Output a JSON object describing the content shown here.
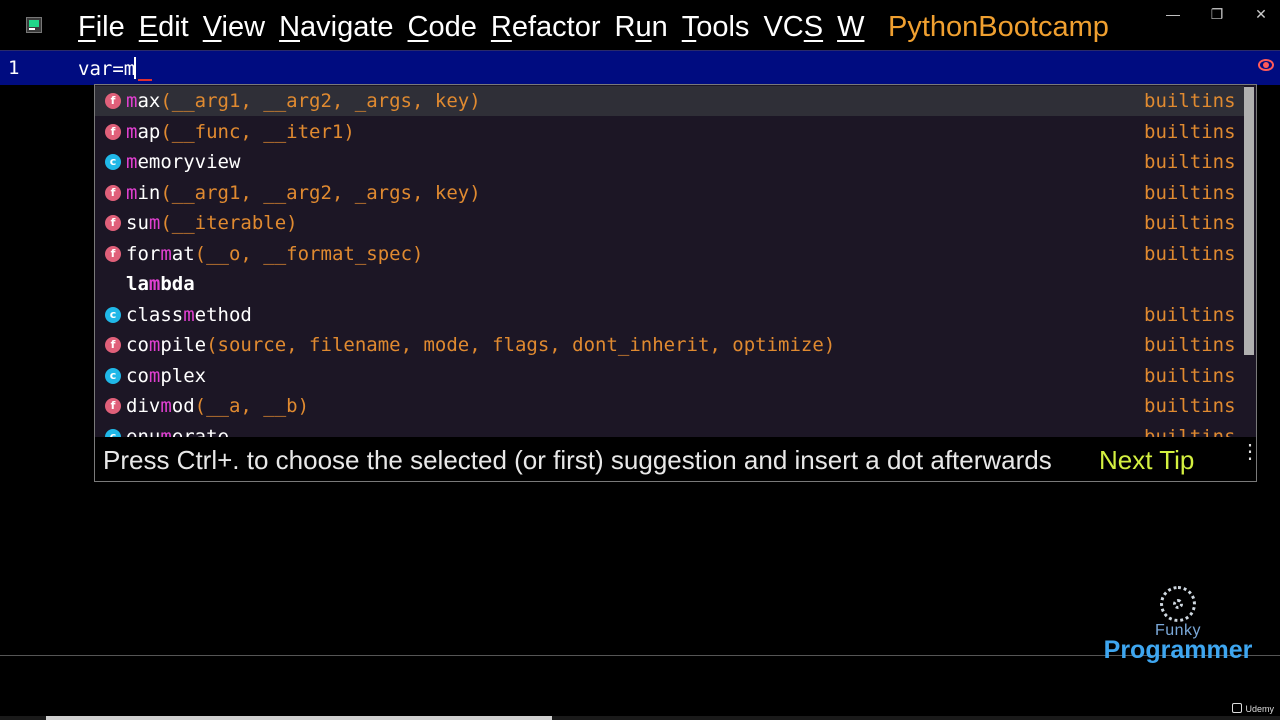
{
  "window": {
    "app_icon": "pycharm-icon",
    "project_title": "PythonBootcamp",
    "controls": {
      "minimize": "—",
      "restore": "❐",
      "close": "✕"
    }
  },
  "menu": [
    {
      "label": "File",
      "id": "file"
    },
    {
      "label": "Edit",
      "id": "edit"
    },
    {
      "label": "View",
      "id": "view"
    },
    {
      "label": "Navigate",
      "id": "navigate"
    },
    {
      "label": "Code",
      "id": "code"
    },
    {
      "label": "Refactor",
      "id": "refactor"
    },
    {
      "label": "Run",
      "id": "run"
    },
    {
      "label": "Tools",
      "id": "tools"
    },
    {
      "label": "VCS",
      "id": "vcs"
    },
    {
      "label": "W",
      "id": "window"
    }
  ],
  "editor": {
    "line_number": "1",
    "code": "var=m"
  },
  "completion": {
    "items": [
      {
        "kind": "f",
        "name": "max",
        "params": "(__arg1, __arg2, _args, key)",
        "type": "builtins",
        "selected": true
      },
      {
        "kind": "f",
        "name": "map",
        "params": "(__func, __iter1)",
        "type": "builtins"
      },
      {
        "kind": "c",
        "name": "memoryview",
        "params": "",
        "type": "builtins"
      },
      {
        "kind": "f",
        "name": "min",
        "params": "(__arg1, __arg2, _args, key)",
        "type": "builtins"
      },
      {
        "kind": "f",
        "name": "sum",
        "params": "(__iterable)",
        "type": "builtins"
      },
      {
        "kind": "f",
        "name": "format",
        "params": "(__o, __format_spec)",
        "type": "builtins"
      },
      {
        "kind": "keyword",
        "name": "lambda",
        "params": "",
        "type": ""
      },
      {
        "kind": "c",
        "name": "classmethod",
        "params": "",
        "type": "builtins"
      },
      {
        "kind": "f",
        "name": "compile",
        "params": "(source, filename, mode, flags, dont_inherit, optimize)",
        "type": "builtins"
      },
      {
        "kind": "c",
        "name": "complex",
        "params": "",
        "type": "builtins"
      },
      {
        "kind": "f",
        "name": "divmod",
        "params": "(__a, __b)",
        "type": "builtins"
      },
      {
        "kind": "c",
        "name": "enumerate",
        "params": "",
        "type": "builtins"
      }
    ],
    "tip_text": "Press Ctrl+. to choose the selected (or first) suggestion and insert a dot afterwards",
    "next_tip_label": "Next Tip",
    "more_icon": "more-vertical-icon"
  },
  "watermark": {
    "line1": "Funky",
    "line2": "Programmer",
    "udemy": "Udemy"
  }
}
